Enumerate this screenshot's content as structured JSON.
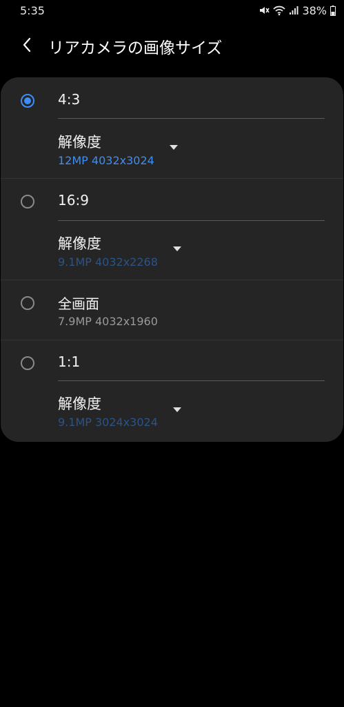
{
  "status_bar": {
    "time": "5:35",
    "battery_percent": "38%",
    "icons": [
      "mute-icon",
      "wifi-icon",
      "signal-icon",
      "battery-icon"
    ]
  },
  "app_bar": {
    "title": "リアカメラの画像サイズ",
    "back_icon": "chevron-left-icon"
  },
  "options": [
    {
      "label": "4:3",
      "selected": true,
      "resolution_label": "解像度",
      "resolution_value": "12MP  4032x3024"
    },
    {
      "label": "16:9",
      "selected": false,
      "resolution_label": "解像度",
      "resolution_value": "9.1MP  4032x2268"
    },
    {
      "label": "全画面",
      "selected": false,
      "subtitle": "7.9MP  4032x1960"
    },
    {
      "label": "1:1",
      "selected": false,
      "resolution_label": "解像度",
      "resolution_value": "9.1MP  3024x3024"
    }
  ],
  "colors": {
    "accent": "#3e8ef7",
    "accent_dim": "#2b5487",
    "card_bg": "#252525",
    "background": "#000000"
  }
}
